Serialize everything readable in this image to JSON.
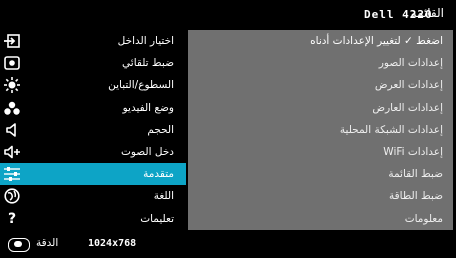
{
  "header": {
    "menu_title": "القائمة",
    "model": "Dell 4220"
  },
  "sidebar": {
    "items": [
      {
        "label": "اختيار الداخل",
        "icon": "input-select-icon"
      },
      {
        "label": "ضبط تلقائي",
        "icon": "auto-adjust-icon"
      },
      {
        "label": "السطوع/التباين",
        "icon": "brightness-icon"
      },
      {
        "label": "وضع الفيديو",
        "icon": "video-mode-icon"
      },
      {
        "label": "الحجم",
        "icon": "volume-icon"
      },
      {
        "label": "دخل الصوت",
        "icon": "audio-input-icon"
      },
      {
        "label": "متقدمة",
        "icon": "advanced-sliders-icon"
      },
      {
        "label": "اللغة",
        "icon": "language-globe-icon"
      },
      {
        "label": "تعليمات",
        "icon": "help-icon"
      }
    ],
    "active_index": 6
  },
  "submenu": {
    "items": [
      "اضغط ✓ لتغيير الإعدادات أدناه",
      "إعدادات الصور",
      "إعدادات العرض",
      "إعدادات العارض",
      "إعدادات الشبكة المحلية",
      "إعدادات WiFi",
      "ضبط القائمة",
      "ضبط الطاقة",
      "معلومات"
    ]
  },
  "footer": {
    "label": "الدقة",
    "value": "1024x768",
    "icon": "resolution-icon"
  },
  "colors": {
    "active": "#0da4c6",
    "panel": "#707070",
    "background": "#000000"
  }
}
